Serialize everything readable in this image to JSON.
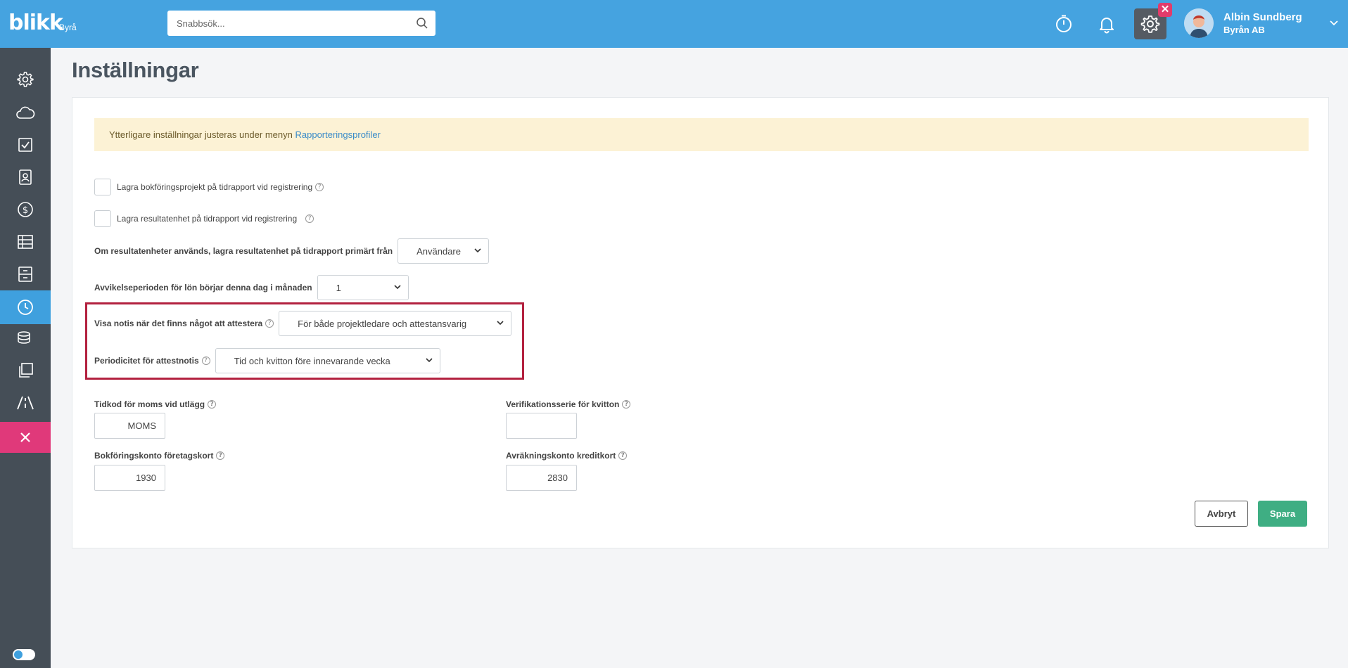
{
  "header": {
    "logo": "blikk",
    "logo_sub": "Byrå",
    "search_placeholder": "Snabbsök...",
    "user_name": "Albin Sundberg",
    "user_company": "Byrån AB",
    "badge": "✕"
  },
  "sidebar": {
    "items": [
      {
        "icon": "gear-icon"
      },
      {
        "icon": "cloud-icon"
      },
      {
        "icon": "checkbox-icon"
      },
      {
        "icon": "contacts-icon"
      },
      {
        "icon": "dollar-icon"
      },
      {
        "icon": "table-icon"
      },
      {
        "icon": "archive-icon"
      },
      {
        "icon": "clock-icon",
        "active": true
      },
      {
        "icon": "coins-icon"
      },
      {
        "icon": "copy-icon"
      },
      {
        "icon": "road-icon"
      },
      {
        "icon": "close-icon"
      }
    ]
  },
  "page": {
    "title": "Inställningar",
    "alert_text": "Ytterligare inställningar justeras under menyn",
    "alert_link": "Rapporteringsprofiler",
    "cb1_label": "Lagra bokföringsprojekt på tidrapport vid registrering",
    "cb2_label": "Lagra resultatenhet på tidrapport vid registrering",
    "sel1_label": "Om resultatenheter används, lagra resultatenhet på tidrapport primärt från",
    "sel1_value": "Användare",
    "sel2_label": "Avvikelseperioden för lön börjar denna dag i månaden",
    "sel2_value": "1",
    "sel3_label": "Visa notis när det finns något att attestera",
    "sel3_value": "För både projektledare och attestansvarig",
    "sel4_label": "Periodicitet för attestnotis",
    "sel4_value": "Tid och kvitton före innevarande vecka",
    "f1_label": "Tidkod för moms vid utlägg",
    "f1_value": "MOMS",
    "f2_label": "Verifikationsserie för kvitton",
    "f2_value": "",
    "f3_label": "Bokföringskonto företagskort",
    "f3_value": "1930",
    "f4_label": "Avräkningskonto kreditkort",
    "f4_value": "2830",
    "help_glyph": "?",
    "cancel_label": "Avbryt",
    "save_label": "Spara"
  }
}
